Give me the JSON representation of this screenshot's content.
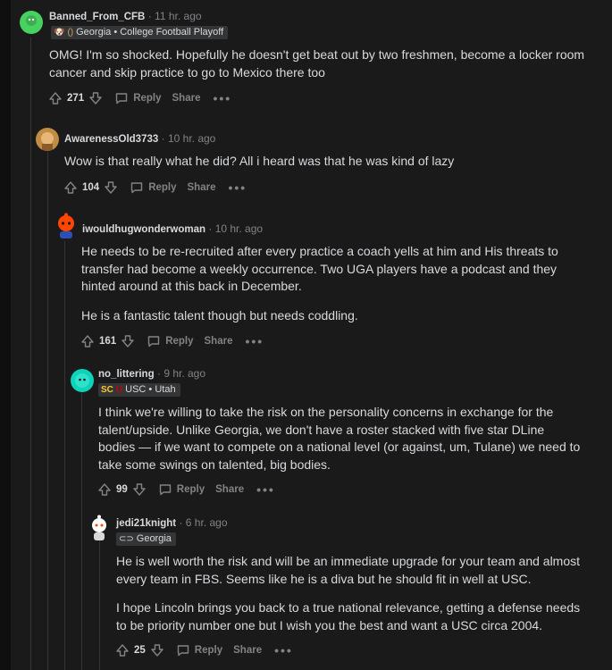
{
  "comments": [
    {
      "username": "Banned_From_CFB",
      "time": "11 hr. ago",
      "flair": "Georgia • College Football Playoff",
      "paragraphs": [
        "OMG! I'm so shocked. Hopefully he doesn't get beat out by two freshmen, become a locker room cancer and skip practice to go to Mexico there too"
      ],
      "score": "271",
      "avatar_color": "#46d160"
    },
    {
      "username": "AwarenessOld3733",
      "time": "10 hr. ago",
      "flair": "",
      "paragraphs": [
        "Wow is that really what he did? All i heard was that he was kind of lazy"
      ],
      "score": "104",
      "avatar_color": "#c18d42"
    },
    {
      "username": "iwouldhugwonderwoman",
      "time": "10 hr. ago",
      "flair": "",
      "paragraphs": [
        "He needs to be re-recruited after every practice a coach yells at him and His threats to transfer had become a weekly occurrence. Two UGA players have a podcast and they hinted around at this back in December.",
        "He is a fantastic talent though but needs coddling."
      ],
      "score": "161",
      "avatar_color": "#ff4500"
    },
    {
      "username": "no_littering",
      "time": "9 hr. ago",
      "flair": "USC • Utah",
      "paragraphs": [
        "I think we're willing to take the risk on the personality concerns in exchange for the talent/upside. Unlike Georgia, we don't have a roster stacked with five star DLine bodies — if we want to compete on a national level (or against, um, Tulane) we need to take some swings on talented, big bodies."
      ],
      "score": "99",
      "avatar_color": "#0dd3bb"
    },
    {
      "username": "jedi21knight",
      "time": "6 hr. ago",
      "flair": "Georgia",
      "paragraphs": [
        "He is well worth the risk and will be an immediate upgrade for your team and almost every team in FBS. Seems like he is a diva but he should fit in well at USC.",
        "I hope Lincoln brings you back to a true national relevance, getting a defense needs to be priority number one but I wish you the best and want a USC circa 2004."
      ],
      "score": "25",
      "avatar_color": "#ffffff"
    }
  ],
  "labels": {
    "reply": "Reply",
    "share": "Share",
    "more": "•••",
    "sep": "·"
  },
  "colors": {
    "background": "#1a1a1b",
    "text": "#d7dadc",
    "muted": "#818384",
    "thread_line": "#343536"
  },
  "icons": [
    "upvote-icon",
    "downvote-icon",
    "reply-bubble-icon",
    "more-options-icon"
  ]
}
